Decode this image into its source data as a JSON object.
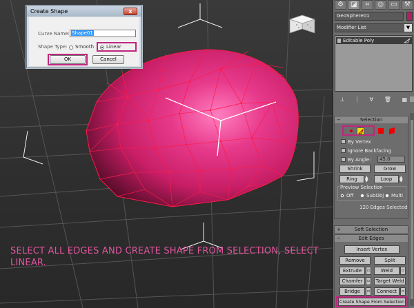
{
  "dialog": {
    "title": "Create Shape",
    "close_label": "x",
    "curve_name_label": "Curve Name:",
    "curve_name_value": "Shape01",
    "shape_type_label": "Shape Type:",
    "smooth_label": "Smooth",
    "linear_label": "Linear",
    "ok_label": "OK",
    "cancel_label": "Cancel",
    "selected_shape_type": "Linear"
  },
  "instruction": "SELECT ALL EDGES AND CREATE SHAPE FROM SELECTION, SELECT LINEAR.",
  "panel": {
    "tabs": [
      {
        "icon": "gear-icon",
        "glyph": "⚙"
      },
      {
        "icon": "modify-icon",
        "glyph": "◪"
      },
      {
        "icon": "hierarchy-icon",
        "glyph": "⌗"
      },
      {
        "icon": "motion-icon",
        "glyph": "◎"
      },
      {
        "icon": "display-icon",
        "glyph": "▭"
      },
      {
        "icon": "utilities-icon",
        "glyph": "⚒"
      }
    ],
    "object_name": "GeoSphere01",
    "object_color": "#b0205f",
    "modifier_list": "Modifier List",
    "modifier_stack": [
      "Editable Poly"
    ],
    "selection": {
      "title": "Selection",
      "by_vertex": "By Vertex",
      "ignore_backfacing": "Ignore Backfacing",
      "by_angle": "By Angle:",
      "angle_value": "45.0",
      "shrink": "Shrink",
      "grow": "Grow",
      "ring": "Ring",
      "loop": "Loop",
      "preview_selection": "Preview Selection",
      "off": "Off",
      "subobj": "SubObj",
      "multi": "Multi",
      "status": "120 Edges Selected"
    },
    "soft_selection_title": "Soft Selection",
    "edit_edges": {
      "title": "Edit Edges",
      "insert_vertex": "Insert Vertex",
      "remove": "Remove",
      "split": "Split",
      "extrude": "Extrude",
      "weld": "Weld",
      "chamfer": "Chamfer",
      "target_weld": "Target Weld",
      "bridge": "Bridge",
      "connect": "Connect",
      "create_shape": "Create Shape From Selection"
    }
  },
  "colors": {
    "accent_highlight": "#c0267e",
    "instruction_text": "#e0559e",
    "mesh_edge": "#ff1a4a"
  }
}
